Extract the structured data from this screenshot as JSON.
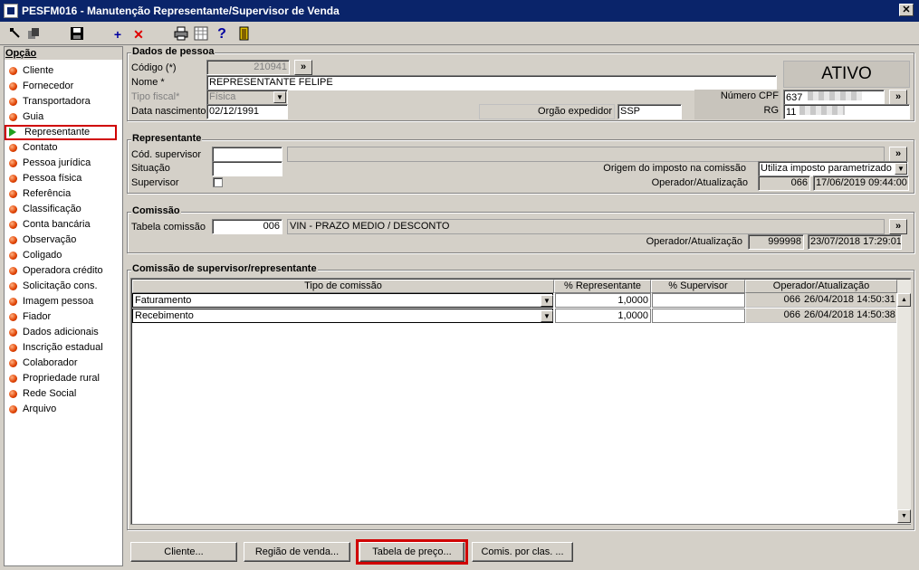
{
  "window": {
    "title": "PESFM016 - Manutenção Representante/Supervisor de Venda",
    "close": "✕"
  },
  "toolbar": {
    "icons": [
      "exit-icon",
      "copy-icon",
      "save-icon",
      "add-icon",
      "delete-icon",
      "print-icon",
      "calculator-icon",
      "help-icon",
      "door-icon"
    ],
    "add": "+",
    "delete": "✕",
    "help": "?"
  },
  "sidebar": {
    "title": "Opção",
    "items": [
      "Cliente",
      "Fornecedor",
      "Transportadora",
      "Guia",
      "Representante",
      "Contato",
      "Pessoa jurídica",
      "Pessoa física",
      "Referência",
      "Classificação",
      "Conta bancária",
      "Observação",
      "Coligado",
      "Operadora crédito",
      "Solicitação cons.",
      "Imagem pessoa",
      "Fiador",
      "Dados adicionais",
      "Inscrição estadual",
      "Colaborador",
      "Propriedade rural",
      "Rede Social",
      "Arquivo"
    ],
    "selected": "Representante"
  },
  "dados_pessoa": {
    "title": "Dados de pessoa",
    "codigo_label": "Código (*)",
    "codigo_value": "210941",
    "nome_label": "Nome *",
    "nome_value": "REPRESENTANTE FELIPE",
    "tipo_fiscal_label": "Tipo fiscal*",
    "tipo_fiscal_value": "Física",
    "data_nasc_label": "Data nascimento",
    "data_nasc_value": "02/12/1991",
    "orgao_label": "Orgão expedidor",
    "orgao_value": "SSP",
    "status": "ATIVO",
    "cpf_label": "Número CPF",
    "cpf_value": "637",
    "rg_label": "RG",
    "rg_value": "11",
    "lookup": "»"
  },
  "representante": {
    "title": "Representante",
    "cod_sup_label": "Cód. supervisor",
    "cod_sup_value": "",
    "situacao_label": "Situação",
    "situacao_value": "",
    "supervisor_label": "Supervisor",
    "origem_label": "Origem do imposto na comissão",
    "origem_value": "Utiliza imposto parametrizado",
    "operador_label": "Operador/Atualização",
    "operador_code": "066",
    "operador_date": "17/06/2019 09:44:00"
  },
  "comissao": {
    "title": "Comissão",
    "tabela_label": "Tabela comissão",
    "tabela_code": "006",
    "tabela_desc": "VIN - PRAZO MEDIO / DESCONTO",
    "operador_label": "Operador/Atualização",
    "operador_code": "999998",
    "operador_date": "23/07/2018 17:29:01"
  },
  "comissao_sup": {
    "title": "Comissão de supervisor/representante",
    "columns": [
      "Tipo de comissão",
      "% Representante",
      "% Supervisor",
      "Operador/Atualização"
    ],
    "rows": [
      {
        "tipo": "Faturamento",
        "rep": "1,0000",
        "sup": "",
        "op": "066",
        "date": "26/04/2018 14:50:31"
      },
      {
        "tipo": "Recebimento",
        "rep": "1,0000",
        "sup": "",
        "op": "066",
        "date": "26/04/2018 14:50:38"
      }
    ]
  },
  "buttons": {
    "cliente": "Cliente...",
    "regiao": "Região de venda...",
    "tabela": "Tabela de preço...",
    "comis": "Comis. por clas. ..."
  }
}
